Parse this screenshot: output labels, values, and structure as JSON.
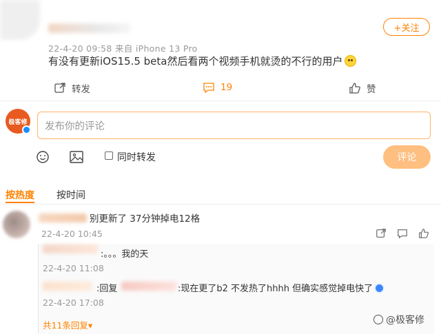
{
  "post": {
    "meta": "22-4-20 09:58  来自 iPhone 13 Pro",
    "text": "有没有更新iOS15.5 beta然后看两个视频手机就烫的不行的用户",
    "follow_label": "+关注",
    "actions": {
      "repost_label": "转发",
      "comment_count": "19",
      "like_label": "赞"
    }
  },
  "composer": {
    "avatar_text": "极客修",
    "placeholder": "发布你的评论",
    "also_repost_label": "同时转发",
    "submit_label": "评论"
  },
  "sort_tabs": {
    "hot_label": "按热度",
    "time_label": "按时间"
  },
  "comment": {
    "text": "别更新了 37分钟掉电12格",
    "time": "22-4-20 10:45",
    "replies": [
      {
        "text": ":。。。我的天",
        "time": "22-4-20 11:08"
      },
      {
        "prefix": ":回复",
        "text": ":现在更了b2 不发热了hhhh 但确实感觉掉电快了",
        "time": "22-4-20 17:08"
      }
    ],
    "more_replies_label": "共11条回复▾"
  },
  "watermark": "@极客修",
  "accent_color": "#ff8200"
}
